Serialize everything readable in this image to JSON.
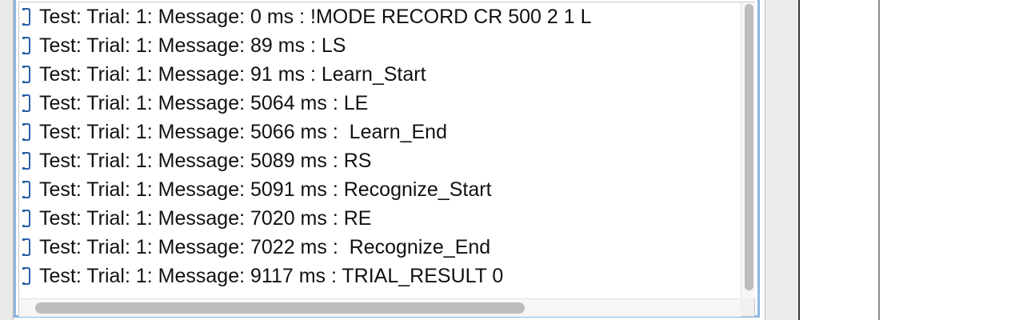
{
  "log": {
    "rows": [
      "Test: Trial: 1: Message: 0 ms : !MODE RECORD CR 500 2 1 L",
      "Test: Trial: 1: Message: 89 ms : LS",
      "Test: Trial: 1: Message: 91 ms : Learn_Start",
      "Test: Trial: 1: Message: 5064 ms : LE",
      "Test: Trial: 1: Message: 5066 ms :  Learn_End",
      "Test: Trial: 1: Message: 5089 ms : RS",
      "Test: Trial: 1: Message: 5091 ms : Recognize_Start",
      "Test: Trial: 1: Message: 7020 ms : RE",
      "Test: Trial: 1: Message: 7022 ms :  Recognize_End",
      "Test: Trial: 1: Message: 9117 ms : TRIAL_RESULT 0"
    ],
    "row_icon": "document-icon"
  },
  "colors": {
    "focus_border": "#8db6e0",
    "icon_blue": "#2a5fa8",
    "text": "#111111"
  }
}
